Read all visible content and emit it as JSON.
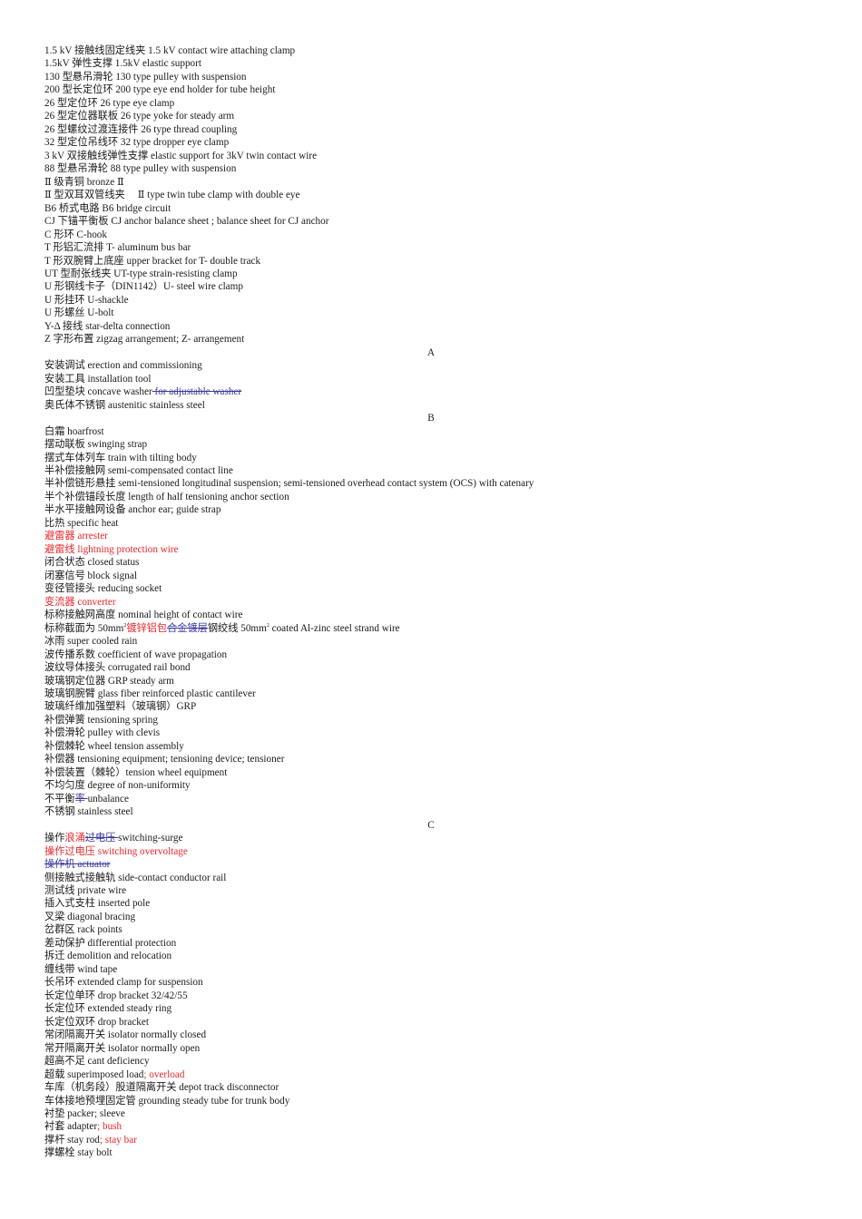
{
  "document": {
    "colors": {
      "text": "#1a1a1a",
      "revision_insert": "#e8262a",
      "revision_delete": "#3a3a9c"
    },
    "lines": [
      {
        "type": "entry",
        "segments": [
          {
            "t": "1.5 kV 接触线固定线夹 1.5 kV contact wire attaching clamp"
          }
        ]
      },
      {
        "type": "entry",
        "segments": [
          {
            "t": "1.5kV 弹性支撑 1.5kV elastic support"
          }
        ]
      },
      {
        "type": "entry",
        "segments": [
          {
            "t": "130 型悬吊滑轮 130 type pulley with suspension"
          }
        ]
      },
      {
        "type": "entry",
        "segments": [
          {
            "t": "200 型长定位环 200 type eye end holder for tube height"
          }
        ]
      },
      {
        "type": "entry",
        "segments": [
          {
            "t": "26 型定位环 26 type eye clamp"
          }
        ]
      },
      {
        "type": "entry",
        "segments": [
          {
            "t": "26 型定位器联板 26 type yoke for steady arm"
          }
        ]
      },
      {
        "type": "entry",
        "segments": [
          {
            "t": "26 型螺纹过渡连接件 26 type thread coupling"
          }
        ]
      },
      {
        "type": "entry",
        "segments": [
          {
            "t": "32 型定位吊线环 32 type dropper eye clamp"
          }
        ]
      },
      {
        "type": "entry",
        "segments": [
          {
            "t": "3 kV 双接触线弹性支撑 elastic support for 3kV twin contact wire"
          }
        ]
      },
      {
        "type": "entry",
        "segments": [
          {
            "t": "88 型悬吊滑轮 88 type pulley with suspension"
          }
        ]
      },
      {
        "type": "entry",
        "segments": [
          {
            "t": " Ⅱ 级青铜 bronze Ⅱ"
          }
        ]
      },
      {
        "type": "entry",
        "segments": [
          {
            "t": " Ⅱ 型双耳双管线夹 　Ⅱ type twin tube clamp with double eye"
          }
        ]
      },
      {
        "type": "entry",
        "segments": [
          {
            "t": "B6 桥式电路 B6 bridge circuit"
          }
        ]
      },
      {
        "type": "entry",
        "segments": [
          {
            "t": "CJ 下锚平衡板 CJ anchor balance sheet ; balance sheet for CJ anchor"
          }
        ]
      },
      {
        "type": "entry",
        "segments": [
          {
            "t": "C 形环 C-hook"
          }
        ]
      },
      {
        "type": "entry",
        "segments": [
          {
            "t": "T 形铝汇流排 T- aluminum bus bar"
          }
        ]
      },
      {
        "type": "entry",
        "segments": [
          {
            "t": "T 形双腕臂上底座 upper bracket for T- double track"
          }
        ]
      },
      {
        "type": "entry",
        "segments": [
          {
            "t": "UT 型耐张线夹 UT-type strain-resisting clamp"
          }
        ]
      },
      {
        "type": "entry",
        "segments": [
          {
            "t": "U 形钢线卡子（DIN1142）U- steel wire clamp"
          }
        ]
      },
      {
        "type": "entry",
        "segments": [
          {
            "t": "U 形挂环 U-shackle"
          }
        ]
      },
      {
        "type": "entry",
        "segments": [
          {
            "t": "U 形螺丝 U-bolt"
          }
        ]
      },
      {
        "type": "entry",
        "segments": [
          {
            "t": "Y-Δ 接线 star-delta connection"
          }
        ]
      },
      {
        "type": "entry",
        "segments": [
          {
            "t": "Z 字形布置 zigzag arrangement; Z- arrangement"
          }
        ]
      },
      {
        "type": "heading",
        "segments": [
          {
            "t": "A"
          }
        ]
      },
      {
        "type": "entry",
        "segments": [
          {
            "t": "安装调试 erection and commissioning"
          }
        ]
      },
      {
        "type": "entry",
        "segments": [
          {
            "t": "安装工具 installation tool"
          }
        ]
      },
      {
        "type": "entry",
        "segments": [
          {
            "t": "凹型垫块 concave washer"
          },
          {
            "t": " for adjustable washer",
            "style": "del"
          }
        ]
      },
      {
        "type": "entry",
        "segments": [
          {
            "t": "奥氏体不锈钢 austenitic stainless steel"
          }
        ]
      },
      {
        "type": "heading",
        "segments": [
          {
            "t": "B"
          }
        ]
      },
      {
        "type": "entry",
        "segments": [
          {
            "t": "白霜 hoarfrost"
          }
        ]
      },
      {
        "type": "entry",
        "segments": [
          {
            "t": "摆动联板 swinging strap"
          }
        ]
      },
      {
        "type": "entry",
        "segments": [
          {
            "t": "摆式车体列车 train with tilting body"
          }
        ]
      },
      {
        "type": "entry",
        "segments": [
          {
            "t": "半补偿接触网 semi-compensated contact line"
          }
        ]
      },
      {
        "type": "entry",
        "segments": [
          {
            "t": "半补偿链形悬挂 semi-tensioned longitudinal suspension; semi-tensioned overhead contact system (OCS) with catenary"
          }
        ]
      },
      {
        "type": "entry",
        "segments": [
          {
            "t": "半个补偿锚段长度 length of half tensioning anchor section"
          }
        ]
      },
      {
        "type": "entry",
        "segments": [
          {
            "t": "半水平接触网设备 anchor ear; guide strap"
          }
        ]
      },
      {
        "type": "entry",
        "segments": [
          {
            "t": "比热 specific heat"
          }
        ]
      },
      {
        "type": "entry",
        "segments": [
          {
            "t": "避雷器 arrester",
            "style": "red"
          }
        ]
      },
      {
        "type": "entry",
        "segments": [
          {
            "t": "避雷线 lightning protection wire",
            "style": "red"
          }
        ]
      },
      {
        "type": "entry",
        "segments": [
          {
            "t": "闭合状态 closed status"
          }
        ]
      },
      {
        "type": "entry",
        "segments": [
          {
            "t": "闭塞信号 block signal"
          }
        ]
      },
      {
        "type": "entry",
        "segments": [
          {
            "t": "变径管接头 reducing socket"
          }
        ]
      },
      {
        "type": "entry",
        "segments": [
          {
            "t": "变流器 converter",
            "style": "red"
          }
        ]
      },
      {
        "type": "entry",
        "segments": [
          {
            "t": "标称接触网高度 nominal height of contact wire"
          }
        ]
      },
      {
        "type": "entry",
        "segments": [
          {
            "t": "标称截面为 50mm"
          },
          {
            "t": "2",
            "style": "sup"
          },
          {
            "t": "镀锌铝包",
            "style": "red"
          },
          {
            "t": "合金镀层",
            "style": "del"
          },
          {
            "t": "钢绞线 50mm"
          },
          {
            "t": "2",
            "style": "sup"
          },
          {
            "t": " coated Al-zinc steel strand wire"
          }
        ]
      },
      {
        "type": "entry",
        "segments": [
          {
            "t": "冰雨 super cooled rain"
          }
        ]
      },
      {
        "type": "entry",
        "segments": [
          {
            "t": "波传播系数 coefficient of wave propagation"
          }
        ]
      },
      {
        "type": "entry",
        "segments": [
          {
            "t": "波纹导体接头 corrugated rail bond"
          }
        ]
      },
      {
        "type": "entry",
        "segments": [
          {
            "t": "玻璃钢定位器 GRP steady arm"
          }
        ]
      },
      {
        "type": "entry",
        "segments": [
          {
            "t": "玻璃钢腕臂 glass fiber reinforced plastic cantilever"
          }
        ]
      },
      {
        "type": "entry",
        "segments": [
          {
            "t": "玻璃纤维加强塑料（玻璃钢）GRP"
          }
        ]
      },
      {
        "type": "entry",
        "segments": [
          {
            "t": "补偿弹簧 tensioning spring"
          }
        ]
      },
      {
        "type": "entry",
        "segments": [
          {
            "t": "补偿滑轮 pulley with clevis"
          }
        ]
      },
      {
        "type": "entry",
        "segments": [
          {
            "t": "补偿棘轮 wheel tension assembly"
          }
        ]
      },
      {
        "type": "entry",
        "segments": [
          {
            "t": "补偿器 tensioning equipment; tensioning device; tensioner"
          }
        ]
      },
      {
        "type": "entry",
        "segments": [
          {
            "t": "补偿装置（棘轮）tension wheel equipment"
          }
        ]
      },
      {
        "type": "entry",
        "segments": [
          {
            "t": "不均匀度 degree of non-uniformity"
          }
        ]
      },
      {
        "type": "entry",
        "segments": [
          {
            "t": "不平衡"
          },
          {
            "t": "率 ",
            "style": "del"
          },
          {
            "t": "unbalance"
          }
        ]
      },
      {
        "type": "entry",
        "segments": [
          {
            "t": "不锈钢 stainless steel"
          }
        ]
      },
      {
        "type": "heading",
        "segments": [
          {
            "t": "C"
          }
        ]
      },
      {
        "type": "entry",
        "segments": [
          {
            "t": "操作"
          },
          {
            "t": "浪涌",
            "style": "red"
          },
          {
            "t": "过电压 ",
            "style": "del"
          },
          {
            "t": "switching-surge"
          }
        ]
      },
      {
        "type": "entry",
        "segments": [
          {
            "t": "操作过电压 switching overvoltage",
            "style": "red"
          }
        ]
      },
      {
        "type": "entry",
        "segments": [
          {
            "t": "操作机 actuator",
            "style": "del"
          }
        ]
      },
      {
        "type": "entry",
        "segments": [
          {
            "t": "侧接触式接触轨 side-contact conductor rail"
          }
        ]
      },
      {
        "type": "entry",
        "segments": [
          {
            "t": "测试线 private wire"
          }
        ]
      },
      {
        "type": "entry",
        "segments": [
          {
            "t": "插入式支柱 inserted pole"
          }
        ]
      },
      {
        "type": "entry",
        "segments": [
          {
            "t": "叉梁 diagonal bracing"
          }
        ]
      },
      {
        "type": "entry",
        "segments": [
          {
            "t": "岔群区 rack points"
          }
        ]
      },
      {
        "type": "entry",
        "segments": [
          {
            "t": "差动保护 differential protection"
          }
        ]
      },
      {
        "type": "entry",
        "segments": [
          {
            "t": "拆迁 demolition and relocation"
          }
        ]
      },
      {
        "type": "entry",
        "segments": [
          {
            "t": "缠线带 wind tape"
          }
        ]
      },
      {
        "type": "entry",
        "segments": [
          {
            "t": "长吊环 extended clamp for suspension"
          }
        ]
      },
      {
        "type": "entry",
        "segments": [
          {
            "t": "长定位单环 drop bracket 32/42/55"
          }
        ]
      },
      {
        "type": "entry",
        "segments": [
          {
            "t": "长定位环 extended steady ring"
          }
        ]
      },
      {
        "type": "entry",
        "segments": [
          {
            "t": "长定位双环 drop bracket"
          }
        ]
      },
      {
        "type": "entry",
        "segments": [
          {
            "t": "常闭隔离开关 isolator normally closed"
          }
        ]
      },
      {
        "type": "entry",
        "segments": [
          {
            "t": "常开隔离开关 isolator normally open"
          }
        ]
      },
      {
        "type": "entry",
        "segments": [
          {
            "t": "超高不足 cant deficiency"
          }
        ]
      },
      {
        "type": "entry",
        "segments": [
          {
            "t": "超载 superimposed load"
          },
          {
            "t": "; overload",
            "style": "red"
          }
        ]
      },
      {
        "type": "entry",
        "segments": [
          {
            "t": "车库（机务段）股道隔离开关 depot track disconnector"
          }
        ]
      },
      {
        "type": "entry",
        "segments": [
          {
            "t": "车体接地预埋固定管 grounding steady tube for trunk body"
          }
        ]
      },
      {
        "type": "entry",
        "segments": [
          {
            "t": "衬垫 packer; sleeve"
          }
        ]
      },
      {
        "type": "entry",
        "segments": [
          {
            "t": "衬套 adapter"
          },
          {
            "t": "; bush",
            "style": "red"
          }
        ]
      },
      {
        "type": "entry",
        "segments": [
          {
            "t": "撑杆 stay rod"
          },
          {
            "t": "; stay bar",
            "style": "red"
          }
        ]
      },
      {
        "type": "entry",
        "segments": [
          {
            "t": "撑螺栓 stay bolt"
          }
        ]
      }
    ]
  }
}
